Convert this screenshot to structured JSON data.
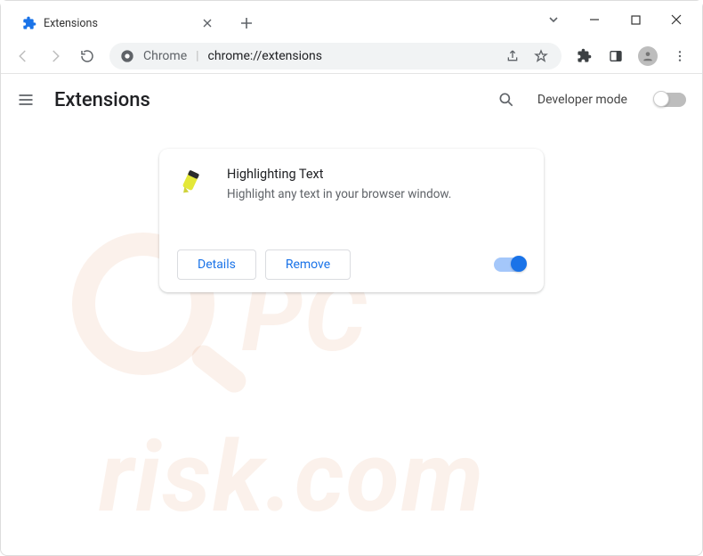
{
  "titlebar": {
    "tab_title": "Extensions"
  },
  "omnibox": {
    "scheme_label": "Chrome",
    "url_text": "chrome://extensions"
  },
  "header": {
    "title": "Extensions",
    "developer_mode_label": "Developer mode"
  },
  "extension_card": {
    "name": "Highlighting Text",
    "description": "Highlight any text in your browser window.",
    "details_label": "Details",
    "remove_label": "Remove"
  },
  "watermark": {
    "line1": "PC",
    "line2": "risk.com"
  }
}
